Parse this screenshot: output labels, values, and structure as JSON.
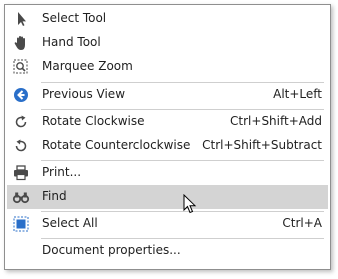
{
  "menu": {
    "items": [
      {
        "label": "Select Tool",
        "shortcut": "",
        "icon": "arrow-pointer-icon"
      },
      {
        "label": "Hand Tool",
        "shortcut": "",
        "icon": "hand-icon"
      },
      {
        "label": "Marquee Zoom",
        "shortcut": "",
        "icon": "marquee-zoom-icon"
      },
      {
        "label": "Previous View",
        "shortcut": "Alt+Left",
        "icon": "back-arrow-circle-icon"
      },
      {
        "label": "Rotate Clockwise",
        "shortcut": "Ctrl+Shift+Add",
        "icon": "rotate-clockwise-icon"
      },
      {
        "label": "Rotate Counterclockwise",
        "shortcut": "Ctrl+Shift+Subtract",
        "icon": "rotate-counterclockwise-icon"
      },
      {
        "label": "Print...",
        "shortcut": "",
        "icon": "printer-icon"
      },
      {
        "label": "Find",
        "shortcut": "",
        "icon": "binoculars-icon"
      },
      {
        "label": "Select All",
        "shortcut": "Ctrl+A",
        "icon": "select-all-icon"
      },
      {
        "label": "Document properties...",
        "shortcut": "",
        "icon": ""
      }
    ],
    "highlighted_item": "Find"
  },
  "colors": {
    "accent_blue": "#2a6fc9",
    "icon_gray": "#5a5a5a",
    "highlight_bg": "#d4d4d4",
    "separator": "#cfcfcf"
  }
}
